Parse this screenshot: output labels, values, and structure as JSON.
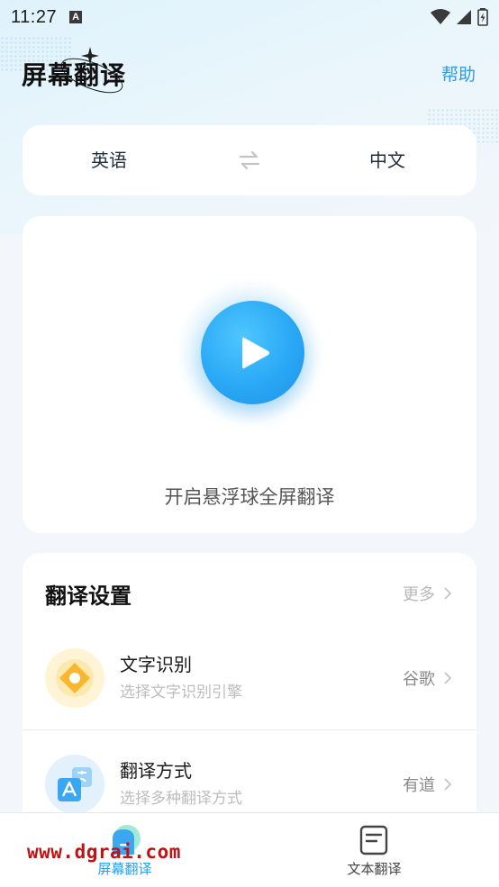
{
  "status_bar": {
    "time": "11:27",
    "notification_letter": "A"
  },
  "header": {
    "title": "屏幕翻译",
    "help_label": "帮助"
  },
  "language_bar": {
    "source": "英语",
    "target": "中文"
  },
  "floating_ball": {
    "label": "开启悬浮球全屏翻译"
  },
  "settings": {
    "title": "翻译设置",
    "more_label": "更多",
    "rows": [
      {
        "name": "文字识别",
        "description": "选择文字识别引擎",
        "value": "谷歌"
      },
      {
        "name": "翻译方式",
        "description": "选择多种翻译方式",
        "value": "有道"
      }
    ]
  },
  "tabs": [
    {
      "label": "屏幕翻译",
      "active": true
    },
    {
      "label": "文本翻译",
      "active": false
    }
  ],
  "watermark": "www.dgrai.com",
  "colors": {
    "accent": "#2a9ee8",
    "play_button": "#29a8f5",
    "watermark": "#c01212"
  }
}
